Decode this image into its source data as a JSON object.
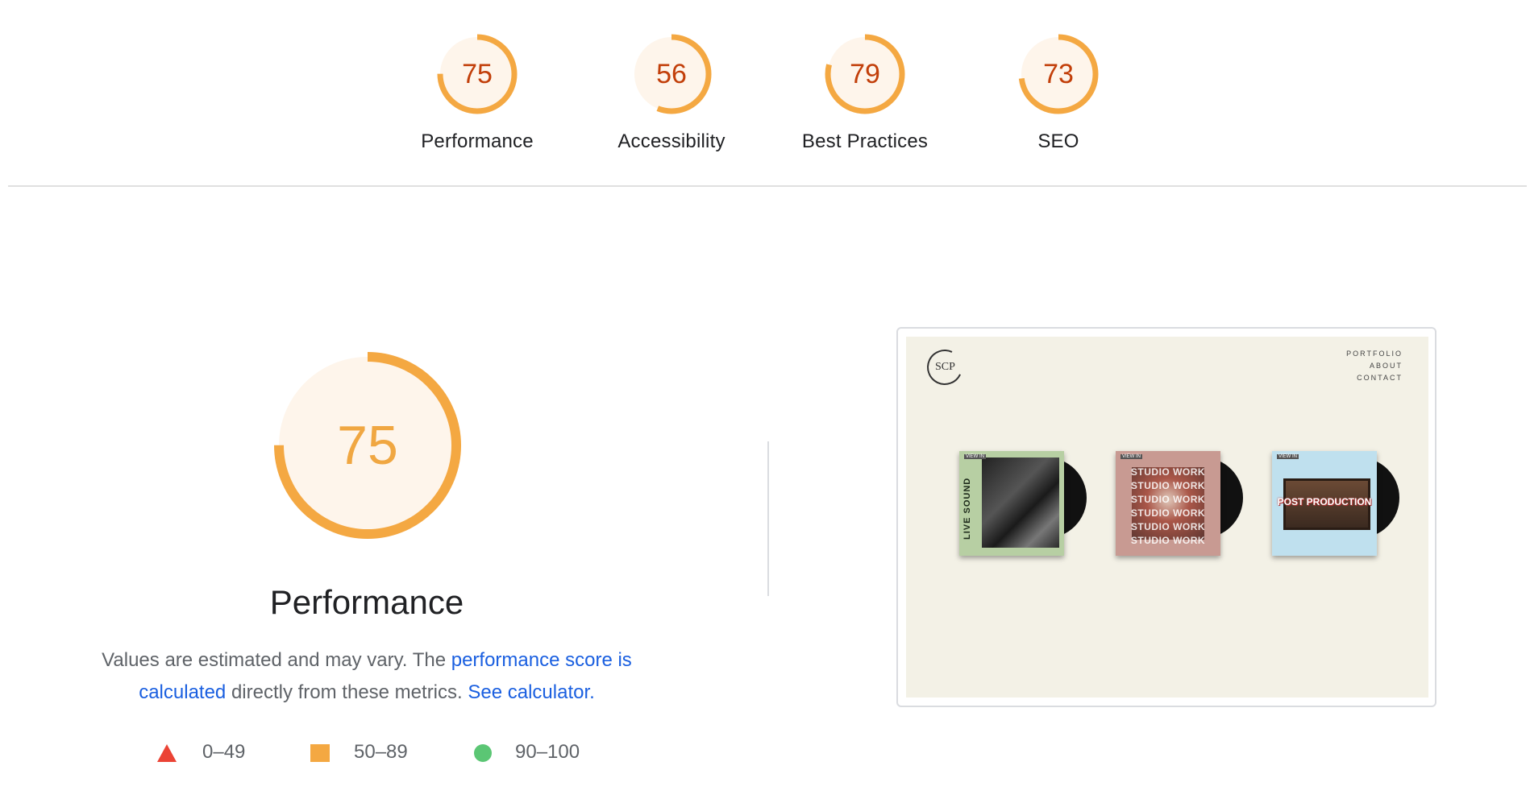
{
  "categories": [
    {
      "label": "Performance",
      "score": 75
    },
    {
      "label": "Accessibility",
      "score": 56
    },
    {
      "label": "Best Practices",
      "score": 79
    },
    {
      "label": "SEO",
      "score": 73
    }
  ],
  "performance": {
    "score": 75,
    "title": "Performance",
    "desc_prefix": "Values are estimated and may vary. The ",
    "desc_link": "performance score is calculated",
    "desc_mid": " directly from these metrics. ",
    "desc_link2": "See calculator."
  },
  "legend": [
    {
      "shape": "triangle-icon",
      "range": "0–49",
      "color": "#eb4335"
    },
    {
      "shape": "square-icon",
      "range": "50–89",
      "color": "#f4a842"
    },
    {
      "shape": "circle-icon",
      "range": "90–100",
      "color": "#5bc674"
    }
  ],
  "colors": {
    "average": "#f4a842",
    "average_text": "#c23f0a",
    "average_big_text": "#f0a742",
    "gauge_bg": "#fef5eb",
    "link": "#1a5fe0"
  },
  "screenshot": {
    "logo": "SCP",
    "nav": [
      "PORTFOLIO",
      "ABOUT",
      "CONTACT"
    ],
    "albums": [
      {
        "tag": "VIEW IN",
        "title": "LIVE SOUND"
      },
      {
        "tag": "VIEW IN",
        "lines": [
          "STUDIO WORK",
          "STUDIO WORK",
          "STUDIO WORK",
          "STUDIO WORK",
          "STUDIO WORK",
          "STUDIO WORK"
        ]
      },
      {
        "tag": "VIEW IN",
        "title": "POST PRODUCTION"
      }
    ]
  }
}
